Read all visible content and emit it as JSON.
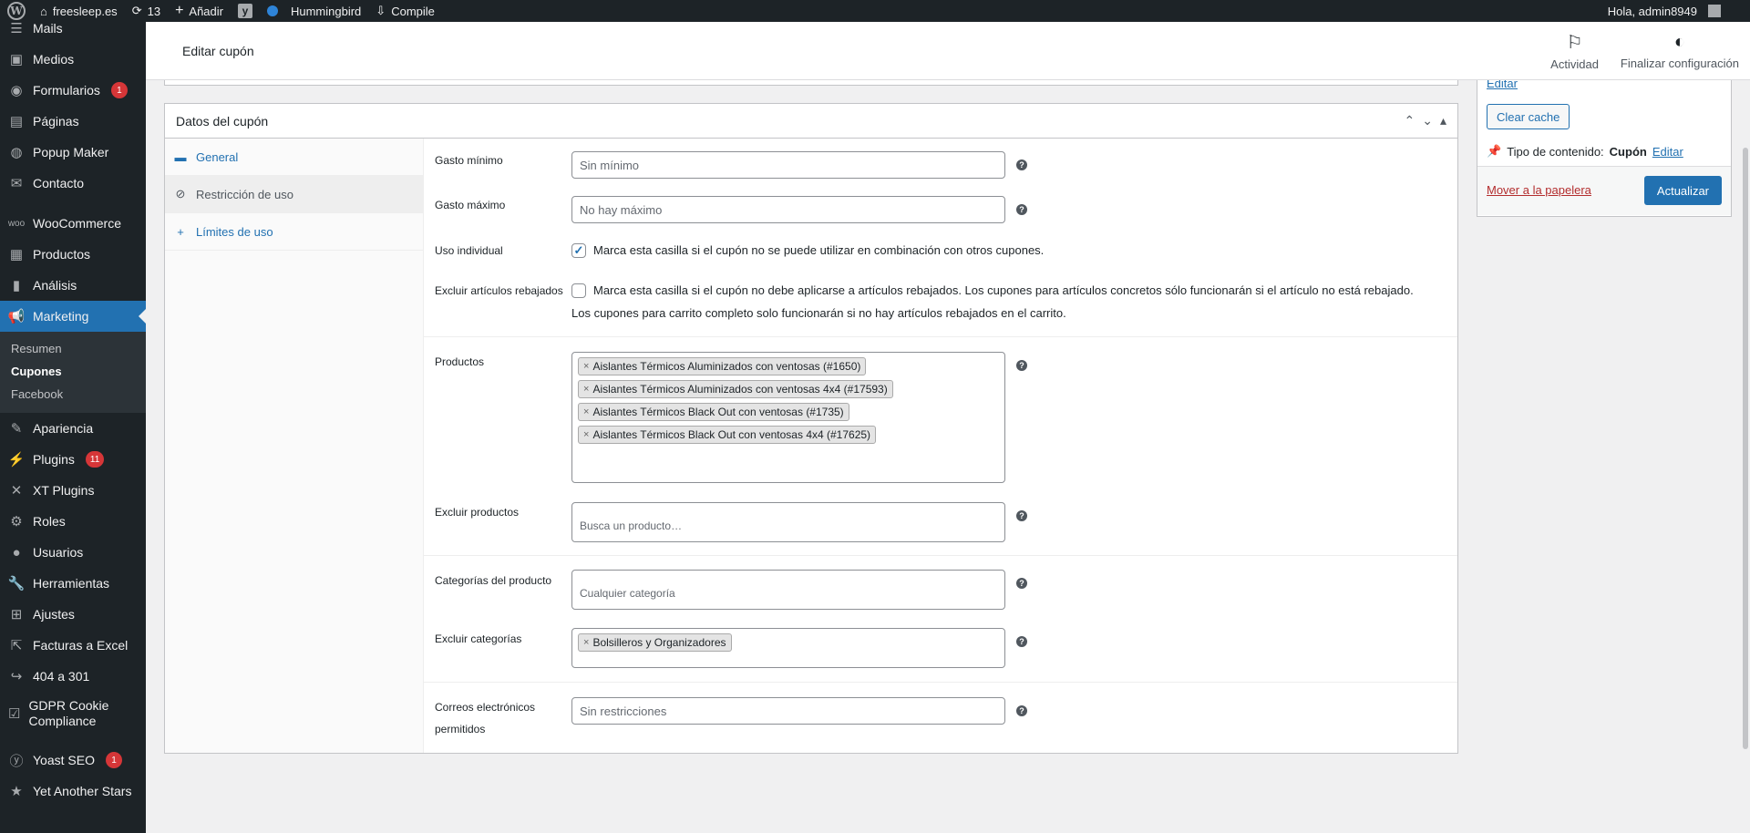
{
  "adminbar": {
    "site": "freesleep.es",
    "updates": "13",
    "add": "Añadir",
    "hummingbird": "Hummingbird",
    "compile": "Compile",
    "greeting": "Hola, admin8949"
  },
  "sidebar": {
    "items": [
      {
        "label": "Mails",
        "icon": "mail-icon"
      },
      {
        "label": "Medios",
        "icon": "media-icon"
      },
      {
        "label": "Formularios",
        "icon": "forms-icon",
        "badge": "1"
      },
      {
        "label": "Páginas",
        "icon": "pages-icon"
      },
      {
        "label": "Popup Maker",
        "icon": "popup-icon"
      },
      {
        "label": "Contacto",
        "icon": "contact-icon"
      },
      {
        "label": "WooCommerce",
        "icon": "woo-icon"
      },
      {
        "label": "Productos",
        "icon": "products-icon"
      },
      {
        "label": "Análisis",
        "icon": "analytics-icon"
      },
      {
        "label": "Marketing",
        "icon": "marketing-icon"
      },
      {
        "label": "Apariencia",
        "icon": "appearance-icon"
      },
      {
        "label": "Plugins",
        "icon": "plugins-icon",
        "badge": "11"
      },
      {
        "label": "XT Plugins",
        "icon": "xt-icon"
      },
      {
        "label": "Roles",
        "icon": "roles-icon"
      },
      {
        "label": "Usuarios",
        "icon": "users-icon"
      },
      {
        "label": "Herramientas",
        "icon": "tools-icon"
      },
      {
        "label": "Ajustes",
        "icon": "settings-icon"
      },
      {
        "label": "Facturas a Excel",
        "icon": "excel-icon"
      },
      {
        "label": "404 a 301",
        "icon": "redirect-icon"
      },
      {
        "label": "GDPR Cookie Compliance",
        "icon": "gdpr-icon"
      },
      {
        "label": "Yoast SEO",
        "icon": "yoast-icon",
        "badge": "1"
      },
      {
        "label": "Yet Another Stars",
        "icon": "stars-icon"
      }
    ],
    "submenu": [
      "Resumen",
      "Cupones",
      "Facebook"
    ]
  },
  "header": {
    "title": "Editar cupón",
    "activity": "Actividad",
    "finish": "Finalizar configuración"
  },
  "publish": {
    "edit": "Editar",
    "clear_cache": "Clear cache",
    "content_type_label": "Tipo de contenido:",
    "content_type_value": "Cupón",
    "content_type_edit": "Editar",
    "trash": "Mover a la papelera",
    "update": "Actualizar"
  },
  "coupon": {
    "title": "Datos del cupón",
    "tabs": [
      {
        "label": "General",
        "icon": "ticket-icon"
      },
      {
        "label": "Restricción de uso",
        "icon": "restricted-icon"
      },
      {
        "label": "Límites de uso",
        "icon": "plus-icon"
      }
    ],
    "min_spend": {
      "label": "Gasto mínimo",
      "placeholder": "Sin mínimo"
    },
    "max_spend": {
      "label": "Gasto máximo",
      "placeholder": "No hay máximo"
    },
    "individual_use": {
      "label": "Uso individual",
      "checked": true,
      "text": "Marca esta casilla si el cupón no se puede utilizar en combinación con otros cupones."
    },
    "exclude_sale": {
      "label": "Excluir artículos rebajados",
      "checked": false,
      "text1": "Marca esta casilla si el cupón no debe aplicarse a artículos rebajados. Los cupones para artículos concretos sólo funcionarán si el artículo no está rebajado.",
      "text2": "Los cupones para carrito completo solo funcionarán si no hay artículos rebajados en el carrito."
    },
    "products": {
      "label": "Productos",
      "items": [
        "Aislantes Térmicos Aluminizados con ventosas (#1650)",
        "Aislantes Térmicos Aluminizados con ventosas 4x4 (#17593)",
        "Aislantes Térmicos Black Out con ventosas (#1735)",
        "Aislantes Térmicos Black Out con ventosas 4x4 (#17625)"
      ]
    },
    "exclude_products": {
      "label": "Excluir productos",
      "placeholder": "Busca un producto…"
    },
    "categories": {
      "label": "Categorías del producto",
      "placeholder": "Cualquier categoría"
    },
    "exclude_categories": {
      "label": "Excluir categorías",
      "items": [
        "Bolsilleros y Organizadores"
      ]
    },
    "emails": {
      "label_line1": "Correos electrónicos",
      "label_line2": "permitidos",
      "placeholder": "Sin restricciones"
    }
  }
}
